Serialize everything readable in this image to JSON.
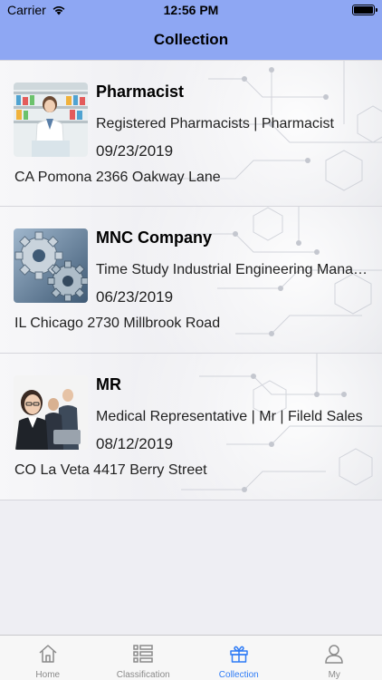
{
  "status_bar": {
    "carrier": "Carrier",
    "time": "12:56 PM"
  },
  "nav": {
    "title": "Collection"
  },
  "items": [
    {
      "title": "Pharmacist",
      "description": "Registered Pharmacists | Pharmacist",
      "date": "09/23/2019",
      "address": "CA Pomona 2366 Oakway Lane",
      "image": "pharmacist-photo"
    },
    {
      "title": "MNC Company",
      "description": "Time Study Industrial Engineering Manager",
      "date": "06/23/2019",
      "address": "IL Chicago 2730 Millbrook Road",
      "image": "gears-photo"
    },
    {
      "title": "MR",
      "description": "Medical Representative | Mr | Fileld Sales",
      "date": "08/12/2019",
      "address": "CO La Veta 4417 Berry Street",
      "image": "business-team-photo"
    }
  ],
  "tabs": [
    {
      "label": "Home",
      "icon": "home-icon",
      "active": false
    },
    {
      "label": "Classification",
      "icon": "list-icon",
      "active": false
    },
    {
      "label": "Collection",
      "icon": "gift-box-icon",
      "active": true
    },
    {
      "label": "My",
      "icon": "person-icon",
      "active": false
    }
  ],
  "colors": {
    "nav_background": "#8ea7f3",
    "tab_active": "#2f7cf6",
    "tab_inactive": "#8a8a8a"
  }
}
